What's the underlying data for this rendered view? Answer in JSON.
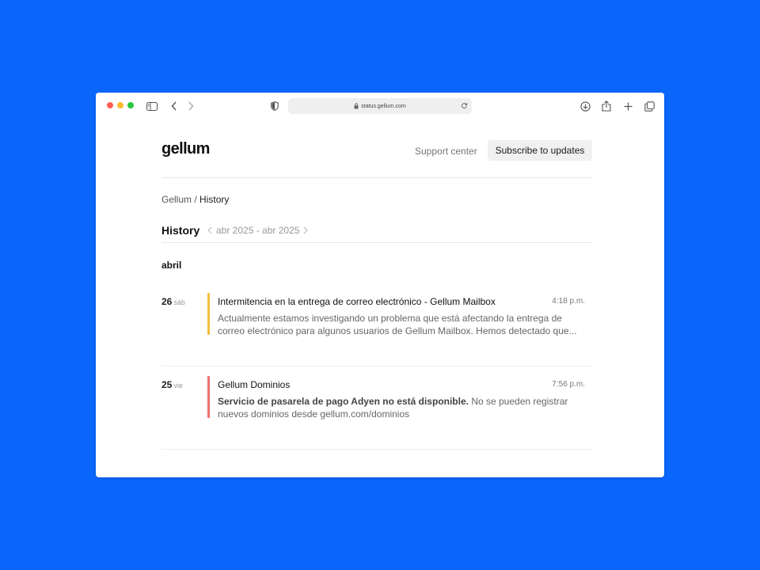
{
  "browser": {
    "url": "status.gellum.com",
    "traffic_lights": [
      "#ff5f57",
      "#febc2e",
      "#28c840"
    ],
    "icons": [
      "sidebar-icon",
      "back-icon",
      "forward-icon",
      "shield-icon",
      "lock-icon",
      "reload-icon",
      "download-icon",
      "share-icon",
      "new-tab-icon",
      "tabs-overview-icon"
    ]
  },
  "header": {
    "logo": "gellum",
    "support_label": "Support center",
    "subscribe_label": "Subscribe to updates"
  },
  "breadcrumb": {
    "root": "Gellum",
    "separator": " / ",
    "current": "History"
  },
  "history": {
    "title": "History",
    "range": "abr 2025 - abr 2025"
  },
  "month": "abril",
  "incidents": [
    {
      "day": "26",
      "weekday": "sáb",
      "title": "Intermitencia en la entrega de correo electrónico - Gellum Mailbox",
      "time": "4:18 p.m.",
      "description": "Actualmente estamos investigando un problema que está afectando la entrega de correo electrónico para algunos usuarios de Gellum Mailbox. Hemos detectado que...",
      "color": "#f5bf3c"
    },
    {
      "day": "25",
      "weekday": "vie",
      "title": "Gellum Dominios",
      "time": "7:56 p.m.",
      "description_bold": "Servicio de pasarela de pago Adyen no está disponible.",
      "description": " No se pueden registrar nuevos dominios desde gellum.com/dominios",
      "color": "#ef6e6e"
    }
  ]
}
